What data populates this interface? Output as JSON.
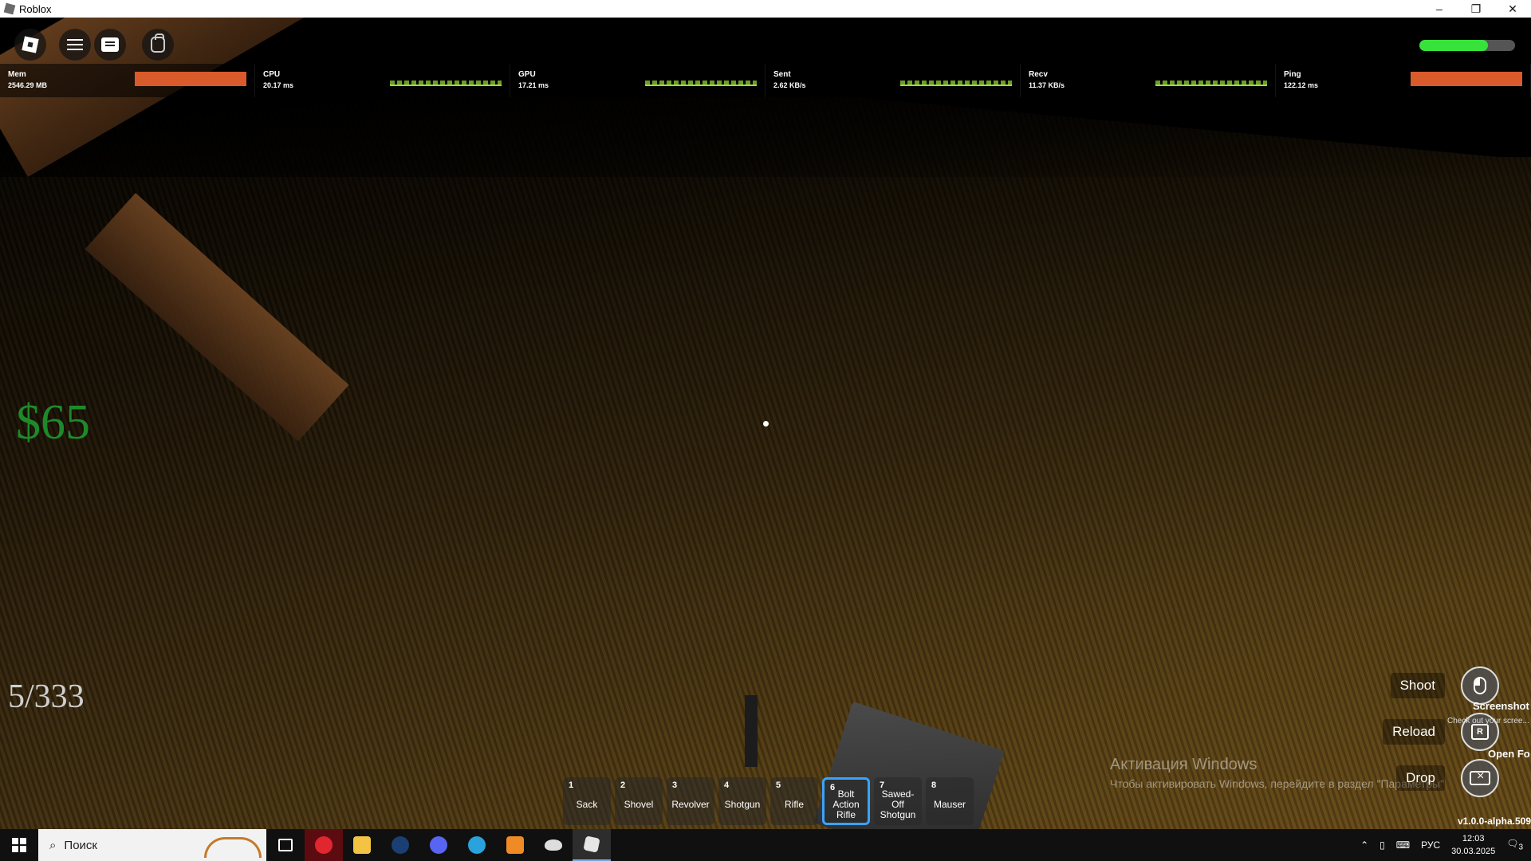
{
  "window": {
    "title": "Roblox",
    "min": "–",
    "max": "❐",
    "close": "✕"
  },
  "stats": [
    {
      "label": "Mem",
      "value": "2546.29 MB",
      "bar": "red"
    },
    {
      "label": "CPU",
      "value": "20.17 ms",
      "bar": "graph"
    },
    {
      "label": "GPU",
      "value": "17.21 ms",
      "bar": "graph"
    },
    {
      "label": "Sent",
      "value": "2.62 KB/s",
      "bar": "graph"
    },
    {
      "label": "Recv",
      "value": "11.37 KB/s",
      "bar": "graph"
    },
    {
      "label": "Ping",
      "value": "122.12 ms",
      "bar": "red"
    }
  ],
  "health": {
    "fraction": 0.72,
    "color": "#37e33a"
  },
  "hud": {
    "money": "$65",
    "ammo": "5/333"
  },
  "hotbar": [
    {
      "num": "1",
      "name": "Sack"
    },
    {
      "num": "2",
      "name": "Shovel"
    },
    {
      "num": "3",
      "name": "Revolver"
    },
    {
      "num": "4",
      "name": "Shotgun"
    },
    {
      "num": "5",
      "name": "Rifle"
    },
    {
      "num": "6",
      "name": "Bolt Action Rifle"
    },
    {
      "num": "7",
      "name": "Sawed-Off Shotgun"
    },
    {
      "num": "8",
      "name": "Mauser"
    }
  ],
  "hotbar_active": 6,
  "actions": {
    "shoot": "Shoot",
    "reload": "Reload",
    "reload_key": "R",
    "drop": "Drop"
  },
  "notice": {
    "screenshot_title": "Screenshot",
    "screenshot_sub": "Check out your scree... see it",
    "open": "Open Fo"
  },
  "version": "v1.0.0-alpha.509",
  "activation": {
    "title": "Активация Windows",
    "subtitle": "Чтобы активировать Windows, перейдите в раздел \"Параметры\""
  },
  "taskbar": {
    "search_placeholder": "Поиск",
    "lang": "РУС",
    "time": "12:03",
    "date": "30.03.2025",
    "notif_count": "3"
  },
  "colors": {
    "accent": "#3aa3ff",
    "money": "#1d8a2a",
    "stat_red": "#d95a2b"
  }
}
